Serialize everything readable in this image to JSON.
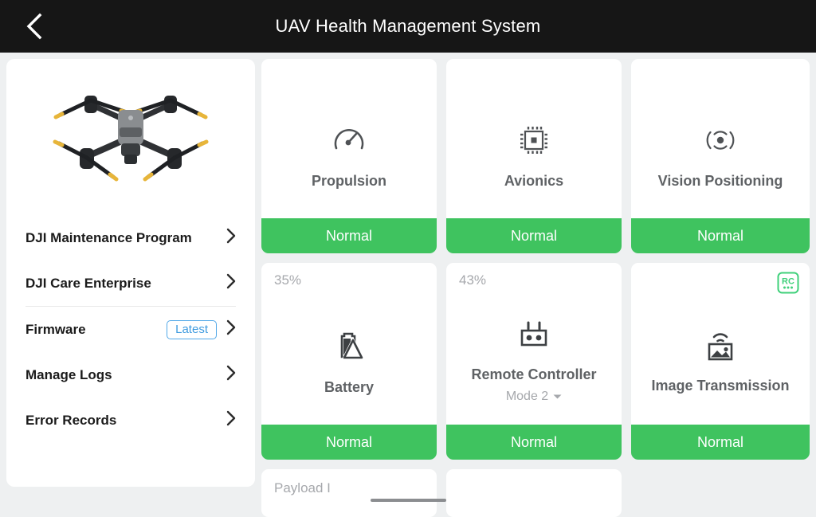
{
  "header": {
    "title": "UAV Health Management System",
    "back_icon": "chevron-left-icon"
  },
  "sidebar": {
    "device_image": "drone-quadcopter-image",
    "items": [
      {
        "label": "DJI Maintenance Program",
        "badge": null,
        "chevron": "chevron-right-icon"
      },
      {
        "label": "DJI Care Enterprise",
        "badge": null,
        "chevron": "chevron-right-icon"
      },
      {
        "label": "Firmware",
        "badge": "Latest",
        "chevron": "chevron-right-icon"
      },
      {
        "label": "Manage Logs",
        "badge": null,
        "chevron": "chevron-right-icon"
      },
      {
        "label": "Error Records",
        "badge": null,
        "chevron": "chevron-right-icon"
      }
    ]
  },
  "cards": [
    {
      "title": "Propulsion",
      "icon": "gauge-icon",
      "percent": null,
      "sub": null,
      "status": "Normal",
      "status_color": "#3fc35f",
      "rc_badge": null
    },
    {
      "title": "Avionics",
      "icon": "chip-icon",
      "percent": null,
      "sub": null,
      "status": "Normal",
      "status_color": "#3fc35f",
      "rc_badge": null
    },
    {
      "title": "Vision Positioning",
      "icon": "radar-sensor-icon",
      "percent": null,
      "sub": null,
      "status": "Normal",
      "status_color": "#3fc35f",
      "rc_badge": null
    },
    {
      "title": "Battery",
      "icon": "battery-icon",
      "percent": "35%",
      "sub": null,
      "status": "Normal",
      "status_color": "#3fc35f",
      "rc_badge": null
    },
    {
      "title": "Remote Controller",
      "icon": "remote-controller-icon",
      "percent": "43%",
      "sub": "Mode 2",
      "status": "Normal",
      "status_color": "#3fc35f",
      "rc_badge": null
    },
    {
      "title": "Image Transmission",
      "icon": "image-transmission-icon",
      "percent": null,
      "sub": null,
      "status": "Normal",
      "status_color": "#3fc35f",
      "rc_badge": "RC"
    }
  ],
  "partial_cards": [
    {
      "label": "Payload I"
    },
    {
      "label": ""
    }
  ]
}
